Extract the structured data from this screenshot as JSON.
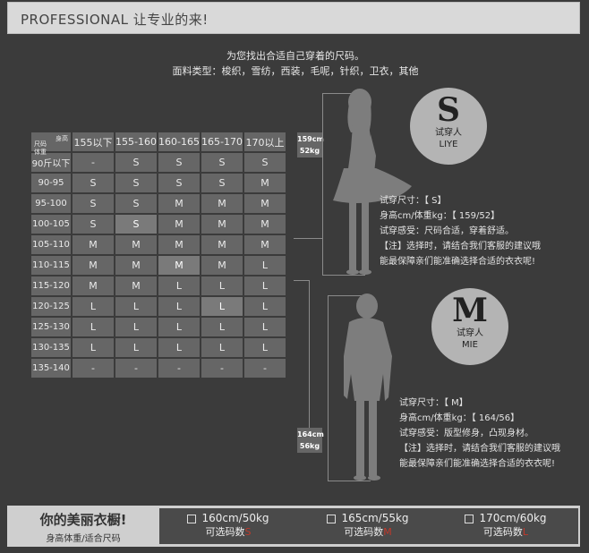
{
  "header": {
    "title": "PROFESSIONAL 让专业的来!"
  },
  "intro": {
    "line1": "为您找出合适自己穿着的尺码。",
    "line2": "面料类型：梭织，雪纺，西装，毛呢，针织，卫衣，其他"
  },
  "table": {
    "corner_height": "身高",
    "corner_size": "尺码",
    "corner_weight": "体重",
    "columns": [
      "155以下",
      "155-160",
      "160-165",
      "165-170",
      "170以上"
    ],
    "rows": [
      {
        "label": "90斤以下",
        "cells": [
          "-",
          "S",
          "S",
          "S",
          "S"
        ]
      },
      {
        "label": "90-95",
        "cells": [
          "S",
          "S",
          "S",
          "S",
          "M"
        ]
      },
      {
        "label": "95-100",
        "cells": [
          "S",
          "S",
          "M",
          "M",
          "M"
        ]
      },
      {
        "label": "100-105",
        "cells": [
          "S",
          "S",
          "M",
          "M",
          "M"
        ]
      },
      {
        "label": "105-110",
        "cells": [
          "M",
          "M",
          "M",
          "M",
          "M"
        ]
      },
      {
        "label": "110-115",
        "cells": [
          "M",
          "M",
          "M",
          "M",
          "L"
        ]
      },
      {
        "label": "115-120",
        "cells": [
          "M",
          "M",
          "L",
          "L",
          "L"
        ]
      },
      {
        "label": "120-125",
        "cells": [
          "L",
          "L",
          "L",
          "L",
          "L"
        ]
      },
      {
        "label": "125-130",
        "cells": [
          "L",
          "L",
          "L",
          "L",
          "L"
        ]
      },
      {
        "label": "130-135",
        "cells": [
          "L",
          "L",
          "L",
          "L",
          "L"
        ]
      },
      {
        "label": "135-140",
        "cells": [
          "-",
          "-",
          "-",
          "-",
          "-"
        ]
      }
    ]
  },
  "model_s": {
    "height_tag": "159cm",
    "weight_tag": "52kg",
    "letter": "S",
    "role": "试穿人",
    "name": "LIYE",
    "info": [
      "试穿尺寸：【 S】",
      "身高cm/体重kg：【 159/52】",
      "试穿感受：尺码合适，穿着舒适。",
      "【注】选择时，请结合我们客服的建议哦",
      "能最保障亲们能准确选择合适的衣衣呢!"
    ]
  },
  "model_m": {
    "height_tag": "164cm",
    "weight_tag": "56kg",
    "letter": "M",
    "role": "试穿人",
    "name": "MIE",
    "info": [
      "试穿尺寸：【 M】",
      "身高cm/体重kg：【 164/56】",
      "试穿感受：版型修身，凸现身材。",
      "【注】选择时，请结合我们客服的建议哦",
      "能最保障亲们能准确选择合适的衣衣呢!"
    ]
  },
  "footer": {
    "title": "你的美丽衣橱!",
    "subtitle": "身高体重/适合尺码",
    "items": [
      {
        "label": "160cm/50kg",
        "sub": "可选码数",
        "size": "S"
      },
      {
        "label": "165cm/55kg",
        "sub": "可选码数",
        "size": "M"
      },
      {
        "label": "170cm/60kg",
        "sub": "可选码数",
        "size": "L"
      }
    ]
  },
  "colors": {
    "background": "#3b3b3b",
    "cell": "#666666",
    "highlight_cell": "#7a7a7a",
    "accent_red": "#c0392b"
  }
}
